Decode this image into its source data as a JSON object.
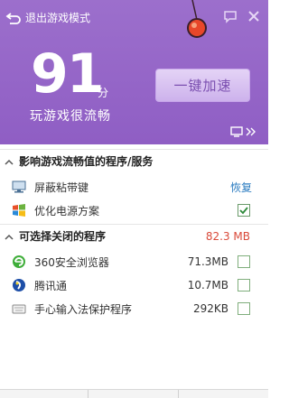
{
  "header": {
    "exit_label": "退出游戏模式",
    "score": "91",
    "unit": "分",
    "status": "玩游戏很流畅",
    "accelerate_label": "一键加速"
  },
  "affecting": {
    "title": "影响游戏流畅值的程序/服务",
    "items": [
      {
        "label": "屏蔽粘带键",
        "action": "恢复"
      },
      {
        "label": "优化电源方案",
        "checked": true
      }
    ]
  },
  "closable": {
    "title": "可选择关闭的程序",
    "total": "82.3 MB",
    "items": [
      {
        "label": "360安全浏览器",
        "memory": "71.3MB"
      },
      {
        "label": "腾讯通",
        "memory": "10.7MB"
      },
      {
        "label": "手心输入法保护程序",
        "memory": "292KB"
      }
    ]
  },
  "colors": {
    "header_bg": "#9567c8",
    "accent_red": "#d94a3a",
    "link_blue": "#2a7bc0",
    "check_green": "#2d8a3a"
  }
}
